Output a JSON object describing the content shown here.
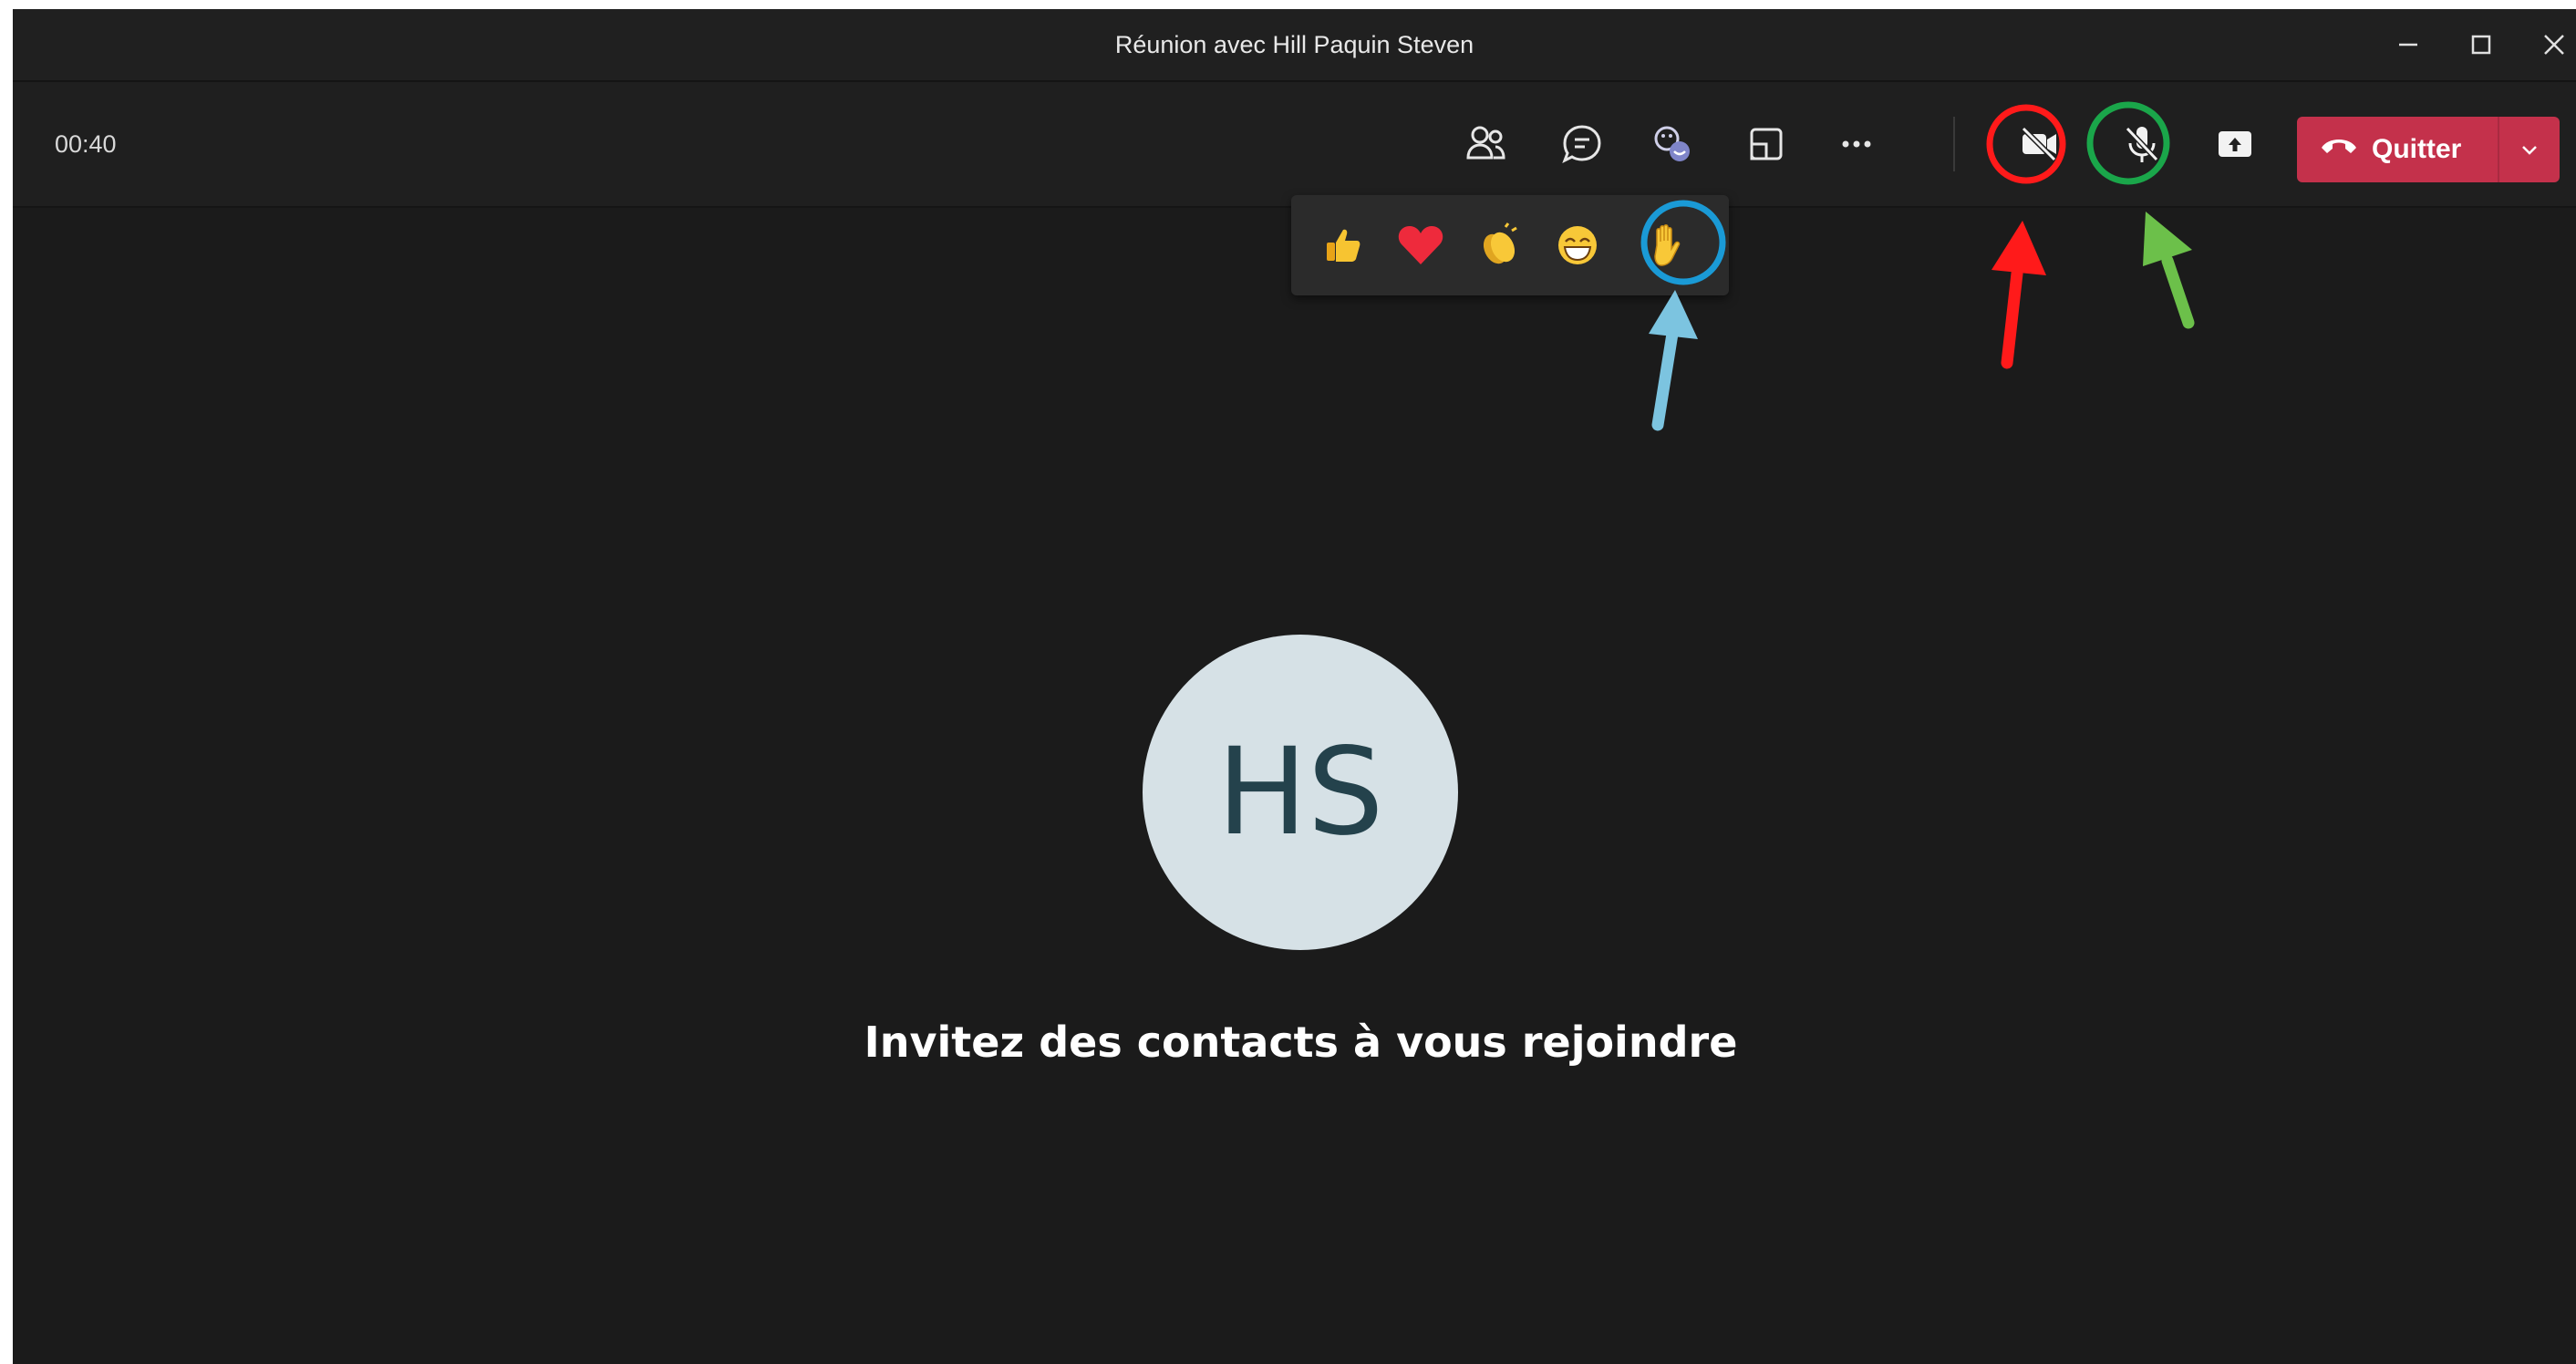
{
  "window": {
    "title": "Réunion avec Hill Paquin Steven",
    "controls": [
      "minimize-icon",
      "maximize-icon",
      "close-icon"
    ]
  },
  "toolbar": {
    "timer": "00:40",
    "buttons": [
      {
        "icon": "people-icon"
      },
      {
        "icon": "chat-icon"
      },
      {
        "icon": "reactions-icon"
      },
      {
        "icon": "rooms-icon"
      },
      {
        "icon": "more-icon"
      },
      {
        "icon": "camera-off-icon",
        "state": "off"
      },
      {
        "icon": "mic-off-icon",
        "state": "muted"
      },
      {
        "icon": "share-screen-icon"
      }
    ],
    "leave_label": "Quitter"
  },
  "reactions": [
    "thumbs-up",
    "heart",
    "clap",
    "laugh",
    "raise-hand"
  ],
  "participant": {
    "initials": "HS"
  },
  "main": {
    "invite_text": "Invitez des contacts à vous rejoindre"
  },
  "colors": {
    "leave_button": "#c4314b",
    "avatar_bg": "#d6e1e6",
    "avatar_text": "#24424c",
    "annotation_red": "#ff1a1a",
    "annotation_green": "#1aa64a",
    "annotation_blue": "#1a9ad6",
    "arrow_light_blue": "#7cc4e0",
    "arrow_green": "#6cc04a"
  }
}
